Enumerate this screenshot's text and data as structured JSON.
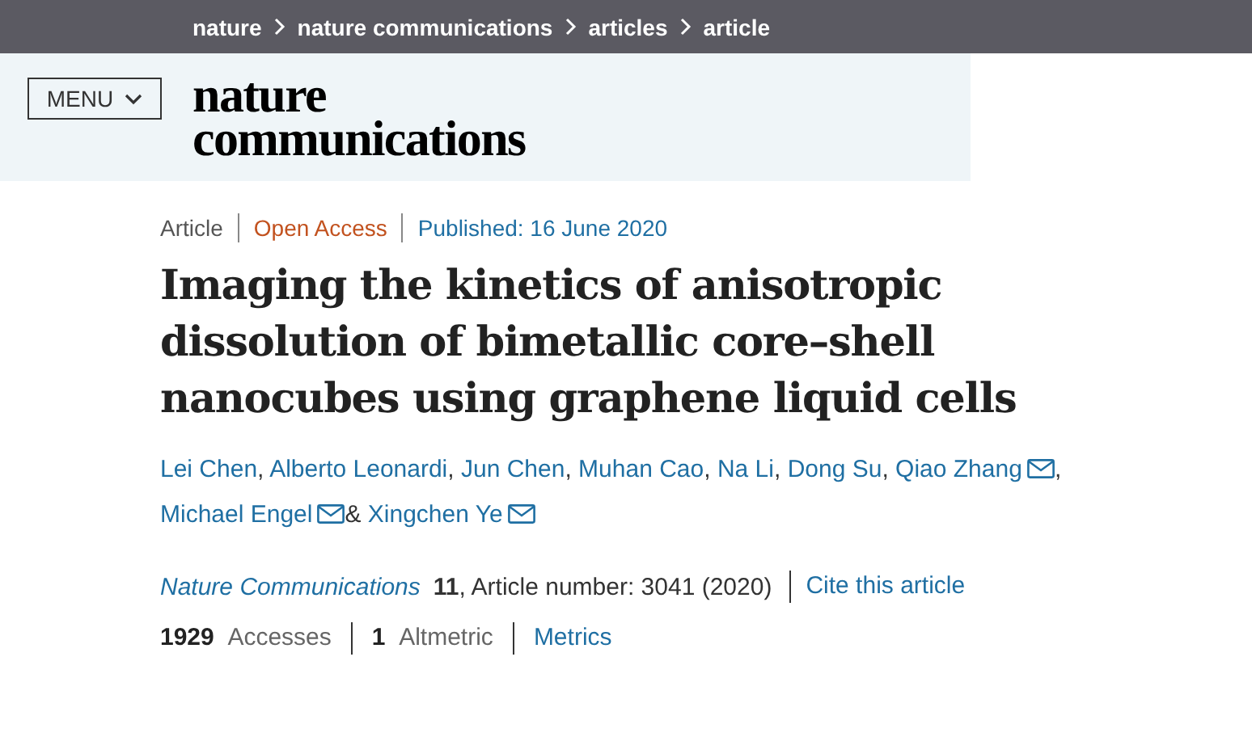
{
  "breadcrumbs": [
    {
      "label": "nature"
    },
    {
      "label": "nature communications"
    },
    {
      "label": "articles"
    },
    {
      "label": "article"
    }
  ],
  "header": {
    "menu_button": "MENU",
    "logo_lines": [
      "nature",
      "communications"
    ]
  },
  "article": {
    "type": "Article",
    "access": "Open Access",
    "published": "Published: 16 June 2020",
    "title": "Imaging the kinetics of anisotropic dissolution of bimetallic core–shell nanocubes using graphene liquid cells",
    "authors": [
      {
        "name": "Lei Chen",
        "email": false,
        "sep": ","
      },
      {
        "name": "Alberto Leonardi",
        "email": false,
        "sep": ","
      },
      {
        "name": "Jun Chen",
        "email": false,
        "sep": ","
      },
      {
        "name": "Muhan Cao",
        "email": false,
        "sep": ","
      },
      {
        "name": "Na Li",
        "email": false,
        "sep": ","
      },
      {
        "name": "Dong Su",
        "email": false,
        "sep": ","
      },
      {
        "name": "Qiao Zhang",
        "email": true,
        "sep": ","
      },
      {
        "name": "Michael Engel",
        "email": true,
        "sep": "&"
      },
      {
        "name": "Xingchen Ye",
        "email": true
      }
    ],
    "journal": "Nature Communications",
    "citation": "**11**, Article number: 3041 (2020)",
    "cite_link": "Cite this article",
    "metrics": [
      {
        "text": "**1929** Accesses"
      },
      {
        "text": "**1** Altmetric"
      }
    ],
    "metrics_link": "Metrics"
  }
}
